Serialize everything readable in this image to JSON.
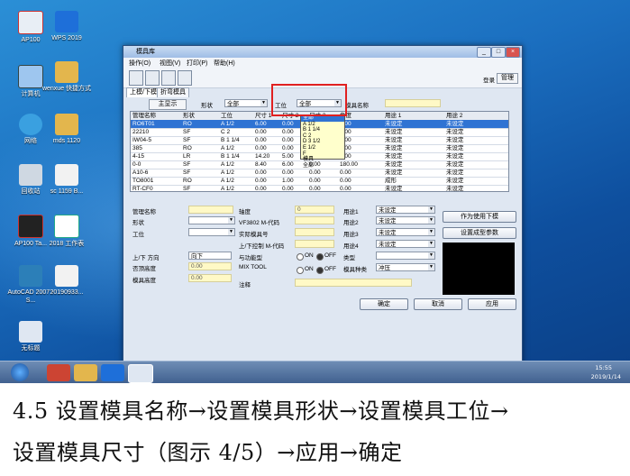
{
  "desktop_icons": [
    {
      "label": "AP100"
    },
    {
      "label": "WPS 2019"
    },
    {
      "label": "计算机"
    },
    {
      "label": "wenxue 快捷方式"
    },
    {
      "label": "网络"
    },
    {
      "label": "mds 1120"
    },
    {
      "label": "回收站"
    },
    {
      "label": "sc 1159 B..."
    },
    {
      "label": "AP100 Ta..."
    },
    {
      "label": "2018 工作表"
    },
    {
      "label": "AutoCAD 2007 - S..."
    },
    {
      "label": "20190933..."
    },
    {
      "label": "无标题"
    }
  ],
  "window": {
    "title": "模具库",
    "menu": [
      "操作(O)",
      "视图(V)",
      "打印(P)",
      "帮助(H)"
    ],
    "right_tabs": [
      "登录",
      "管理"
    ],
    "tabs": [
      "上模/下模",
      "折弯模具"
    ],
    "main_button": "主显示",
    "filter": {
      "shape_label": "形状",
      "shape_value": "全部",
      "station_label": "工位",
      "station_value": "全部",
      "name_label": "模具名称"
    },
    "grid": {
      "headers": [
        "管理名称",
        "形状",
        "工位",
        "尺寸 1",
        "尺寸 2",
        "尺寸 3",
        "角度",
        "用途 1",
        "用途 2"
      ],
      "rows": [
        [
          "RO6T01",
          "RO",
          "A 1/2",
          "6.00",
          "0.00",
          "0.00",
          "0.00",
          "未设定",
          "未设定"
        ],
        [
          "22210",
          "SF",
          "C 2",
          "0.00",
          "0.00",
          "0.00",
          "0.00",
          "未设定",
          "未设定"
        ],
        [
          "IW04-5",
          "SF",
          "B 1 1/4",
          "0.00",
          "0.00",
          "0.00",
          "0.00",
          "未设定",
          "未设定"
        ],
        [
          "385",
          "RO",
          "A 1/2",
          "0.00",
          "0.00",
          "0.00",
          "0.00",
          "未设定",
          "未设定"
        ],
        [
          "4-15",
          "LR",
          "B 1 1/4",
          "14.20",
          "5.00",
          "0.00",
          "0.00",
          "未设定",
          "未设定"
        ],
        [
          "0-0",
          "SF",
          "A 1/2",
          "8.40",
          "6.00",
          "0.00",
          "180.00",
          "未设定",
          "未设定"
        ],
        [
          "A10-6",
          "SF",
          "A 1/2",
          "0.00",
          "0.00",
          "0.00",
          "0.00",
          "未设定",
          "未设定"
        ],
        [
          "TO8001",
          "RO",
          "A 1/2",
          "0.00",
          "1.00",
          "0.00",
          "0.00",
          "成形",
          "未设定"
        ],
        [
          "RT-CF0",
          "SF",
          "A 1/2",
          "0.00",
          "0.00",
          "0.00",
          "0.00",
          "未设定",
          "未设定"
        ]
      ]
    },
    "dropdown_options": [
      "全部",
      "A 1/2",
      "B 1 1/4",
      "C 2",
      "D 3 1/2",
      "E 1/2",
      "F",
      "模具",
      "全部"
    ],
    "detail": {
      "labels_left": [
        "管理名称",
        "形状",
        "工位",
        "上/下 方向",
        "否顶高度",
        "模具高度"
      ],
      "labels_mid": [
        "轴度",
        "VF3802 M-代码",
        "实际模具号",
        "上/下控制 M-代码",
        "与功能型",
        "MIX TOOL",
        "注释"
      ],
      "labels_right": [
        "用途1",
        "用途2",
        "用途3",
        "用途4",
        "类型",
        "模具种类"
      ],
      "direction_value": "向下",
      "height_value_1": "0.00",
      "height_value_2": "0.00",
      "axis_value": "0",
      "combo_unset": "未设定",
      "tool_kind_value": "冲压",
      "on_label": "ON",
      "off_label": "OFF",
      "btn_top": "作为使用下模",
      "btn_set": "设置成型参数"
    },
    "footer_buttons": [
      "确定",
      "取消",
      "应用"
    ]
  },
  "taskbar": {
    "time": "15:55",
    "date": "2019/1/14"
  },
  "caption": {
    "line1": "4.5 设置模具名称→设置模具形状→设置模具工位→",
    "line2": "设置模具尺寸（图示 4/5）→应用→确定"
  }
}
